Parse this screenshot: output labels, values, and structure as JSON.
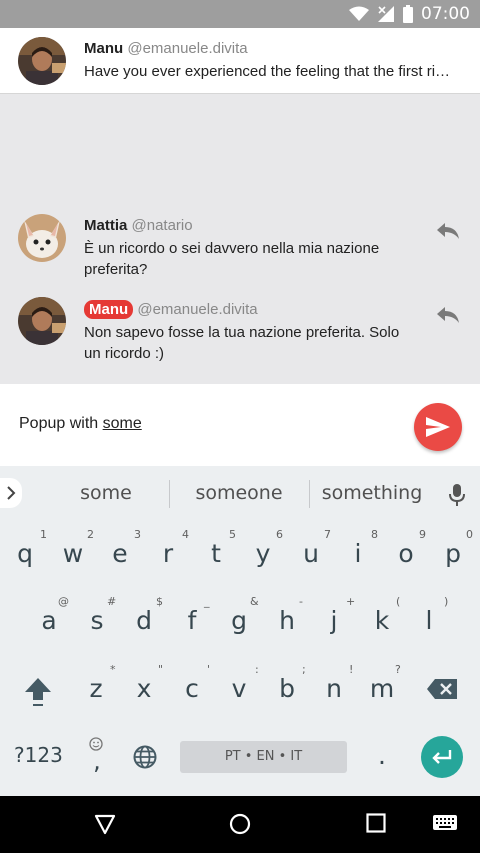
{
  "status_bar": {
    "time": "07:00"
  },
  "header_tweet": {
    "name": "Manu",
    "handle": "@emanuele.divita",
    "text": "Have you ever experienced the feeling that the first ri…"
  },
  "replies": [
    {
      "name": "Mattia",
      "handle": "@natario",
      "text_line1": "È un ricordo o sei davvero nella mia nazione",
      "text_line2": "preferita?"
    },
    {
      "name": "Manu",
      "handle": "@emanuele.divita",
      "text_line1": "Non sapevo fosse la tua nazione preferita. Solo",
      "text_line2": "un ricordo :)"
    }
  ],
  "composer": {
    "text_prefix": "Popup with ",
    "text_underlined": "some"
  },
  "keyboard": {
    "suggestions": [
      "some",
      "someone",
      "something"
    ],
    "row1": [
      "q",
      "w",
      "e",
      "r",
      "t",
      "y",
      "u",
      "i",
      "o",
      "p"
    ],
    "row1_hints": [
      "1",
      "2",
      "3",
      "4",
      "5",
      "6",
      "7",
      "8",
      "9",
      "0"
    ],
    "row2": [
      "a",
      "s",
      "d",
      "f",
      "g",
      "h",
      "j",
      "k",
      "l"
    ],
    "row2_hints": [
      "@",
      "#",
      "$",
      "_",
      "&",
      "-",
      "+",
      "(",
      ")"
    ],
    "row3": [
      "z",
      "x",
      "c",
      "v",
      "b",
      "n",
      "m"
    ],
    "row3_hints": [
      "*",
      "\"",
      "'",
      ":",
      ";",
      "!",
      "?"
    ],
    "symbols_label": "?123",
    "comma": ",",
    "period": ".",
    "space_label": "PT • EN • IT"
  },
  "colors": {
    "accent_red": "#ea4a45",
    "enter_teal": "#26a69a",
    "status_gray": "#9e9e9e"
  }
}
